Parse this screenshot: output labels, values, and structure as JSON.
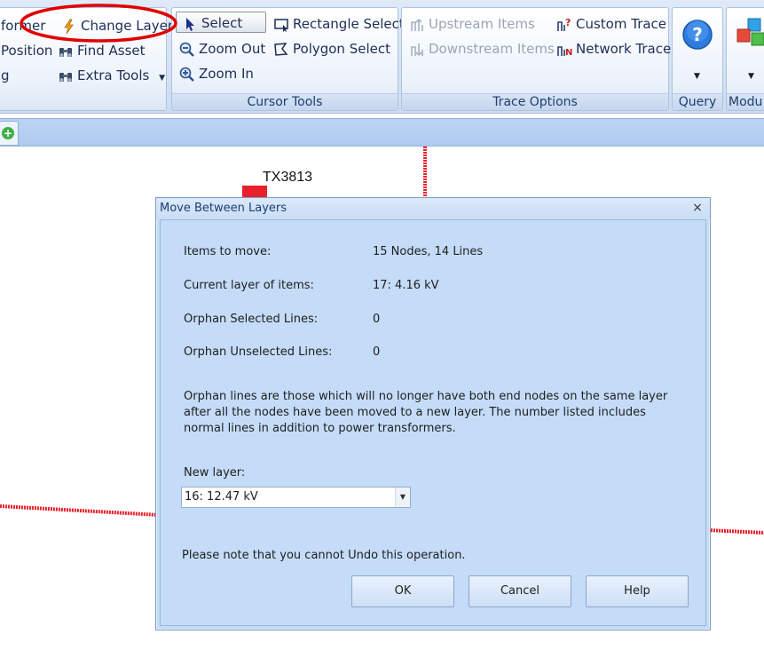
{
  "ribbon": {
    "group1": {
      "items": [
        "former",
        "Position",
        "g"
      ],
      "change_layer": "Change Layer",
      "find_asset": "Find Asset",
      "extra_tools": "Extra Tools"
    },
    "cursor_tools": {
      "label": "Cursor Tools",
      "select": "Select",
      "zoom_out": "Zoom Out",
      "zoom_in": "Zoom In",
      "rectangle_select": "Rectangle Select",
      "polygon_select": "Polygon Select"
    },
    "trace_options": {
      "label": "Trace Options",
      "upstream": "Upstream Items",
      "downstream": "Downstream Items",
      "custom_trace": "Custom Trace",
      "network_trace": "Network Trace"
    },
    "query": {
      "label": "Query"
    },
    "modules": {
      "label": "Modu"
    }
  },
  "canvas": {
    "label": "TX3813"
  },
  "dialog": {
    "title": "Move Between Layers",
    "close": "×",
    "rows": [
      {
        "label": "Items to move:",
        "value": "15 Nodes, 14 Lines"
      },
      {
        "label": "Current layer of items:",
        "value": "17: 4.16 kV"
      },
      {
        "label": "Orphan Selected Lines:",
        "value": "0"
      },
      {
        "label": "Orphan Unselected Lines:",
        "value": "0"
      }
    ],
    "note": "Orphan lines are those which will no longer have both end nodes on the same layer after all the nodes have been moved to a new layer. The number listed includes normal lines in addition to power transformers.",
    "new_layer_label": "New layer:",
    "new_layer_value": "16: 12.47 kV",
    "undo_note": "Please note that you cannot Undo this operation.",
    "buttons": {
      "ok": "OK",
      "cancel": "Cancel",
      "help": "Help"
    }
  },
  "colors": {
    "trace_line": "#e8202c",
    "annotation": "#e00000",
    "dialog_bg": "#c4dcf8"
  }
}
